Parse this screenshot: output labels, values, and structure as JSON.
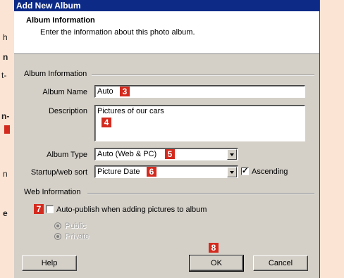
{
  "left_page": {
    "fragments": [
      "h",
      "n",
      "t-",
      "n-",
      "n",
      "e"
    ]
  },
  "dialog": {
    "title": "Add New Album",
    "header_title": "Album Information",
    "header_subtitle": "Enter the information about this photo album.",
    "album_info_group": "Album Information",
    "album_name_label": "Album Name",
    "album_name_value": "Auto",
    "description_label": "Description",
    "description_value": "Pictures of our cars",
    "album_type_label": "Album Type",
    "album_type_value": "Auto (Web & PC)",
    "sort_label": "Startup/web sort",
    "sort_value": "Picture Date",
    "ascending_label": "Ascending",
    "ascending_checked": true,
    "web_info_group": "Web Information",
    "autopublish_label": "Auto-publish when adding pictures to album",
    "autopublish_checked": false,
    "radio_public": "Public",
    "radio_private": "Private",
    "help_button": "Help",
    "ok_button": "OK",
    "cancel_button": "Cancel"
  },
  "callouts": [
    "3",
    "4",
    "5",
    "6",
    "7",
    "8"
  ],
  "colors": {
    "page_background": "#fbe4d3",
    "title_bar": "#0c2a86",
    "callout_red": "#d42a1e",
    "dialog_face": "#d4d0c8"
  }
}
